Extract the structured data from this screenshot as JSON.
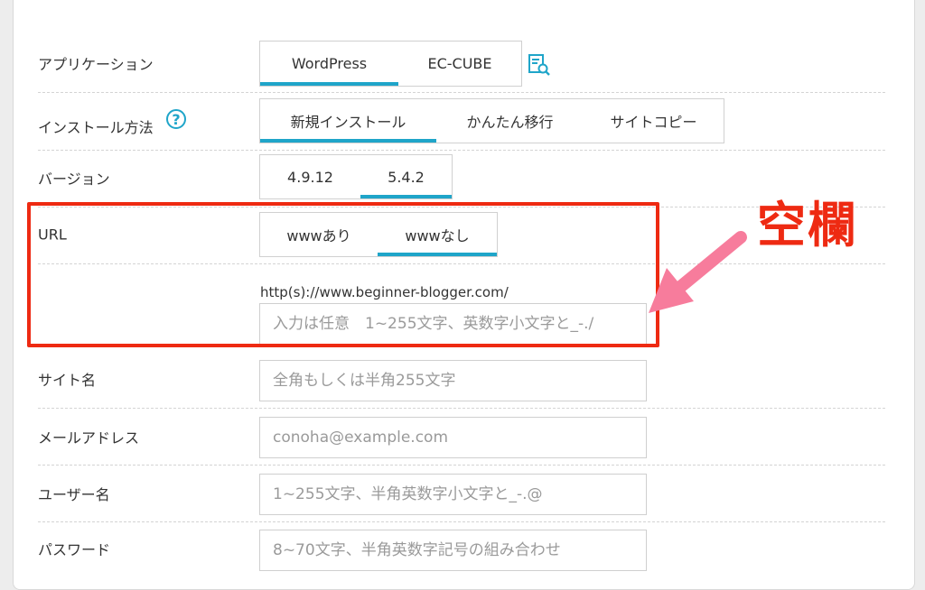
{
  "form": {
    "application": {
      "label": "アプリケーション",
      "options": [
        "WordPress",
        "EC-CUBE"
      ],
      "selected": "WordPress"
    },
    "install_method": {
      "label": "インストール方法",
      "help_icon": "?",
      "options": [
        "新規インストール",
        "かんたん移行",
        "サイトコピー"
      ],
      "selected": "新規インストール"
    },
    "version": {
      "label": "バージョン",
      "options": [
        "4.9.12",
        "5.4.2"
      ],
      "selected": "5.4.2"
    },
    "url": {
      "label": "URL",
      "options": [
        "wwwあり",
        "wwwなし"
      ],
      "selected": "wwwなし",
      "prefix": "http(s)://www.beginner-blogger.com/",
      "value": "",
      "placeholder": "入力は任意　1~255文字、英数字小文字と_-./"
    },
    "site_name": {
      "label": "サイト名",
      "value": "",
      "placeholder": "全角もしくは半角255文字"
    },
    "email": {
      "label": "メールアドレス",
      "value": "",
      "placeholder": "conoha@example.com"
    },
    "username": {
      "label": "ユーザー名",
      "value": "",
      "placeholder": "1~255文字、半角英数字小文字と_-.@"
    },
    "password": {
      "label": "パスワード",
      "value": "",
      "placeholder": "8~70文字、半角英数字記号の組み合わせ"
    }
  },
  "annotation": {
    "text": "空欄",
    "color": "#ee2a12"
  },
  "colors": {
    "accent": "#1fa5c9",
    "annotation_red": "#ee2a12",
    "arrow_pink": "#f77c9c"
  }
}
